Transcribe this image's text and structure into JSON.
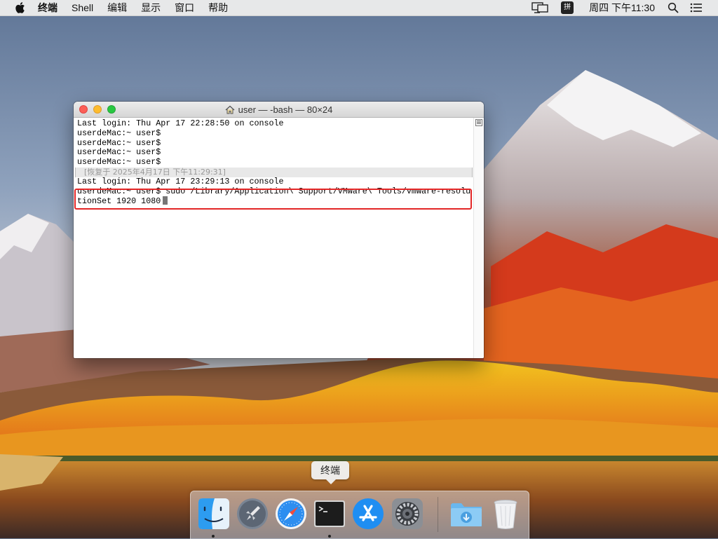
{
  "menubar": {
    "apple_icon": "apple-logo-icon",
    "app_name": "终端",
    "items": [
      "Shell",
      "编辑",
      "显示",
      "窗口",
      "帮助"
    ],
    "status": {
      "airplay_icon": "airplay-display-icon",
      "input_method": "拼",
      "clock": "周四 下午11:30",
      "search_icon": "spotlight-search-icon",
      "notification_icon": "notification-center-icon"
    }
  },
  "window": {
    "title": "user — -bash — 80×24",
    "title_icon": "home-folder-icon",
    "lines": [
      "Last login: Thu Apr 17 22:28:50 on console",
      "userdeMac:~ user$",
      "userdeMac:~ user$",
      "userdeMac:~ user$",
      "userdeMac:~ user$"
    ],
    "restored": "[恢复于 2025年4月17日 下午11:29:31]",
    "lines2": [
      "Last login: Thu Apr 17 23:29:13 on console",
      "userdeMac:~ user$ sudo /Library/Application\\ Support/VMware\\ Tools/vmware-resolu",
      "tionSet 1920 1080"
    ],
    "highlight_color": "#e32626"
  },
  "tooltip": {
    "text": "终端"
  },
  "dock": {
    "items": [
      {
        "name": "finder",
        "icon": "finder-icon",
        "running": true
      },
      {
        "name": "launchpad",
        "icon": "launchpad-rocket-icon",
        "running": false
      },
      {
        "name": "safari",
        "icon": "safari-compass-icon",
        "running": false
      },
      {
        "name": "terminal",
        "icon": "terminal-icon",
        "running": true
      },
      {
        "name": "app-store",
        "icon": "app-store-icon",
        "running": false
      },
      {
        "name": "system-preferences",
        "icon": "system-preferences-gear-icon",
        "running": false
      },
      {
        "name": "downloads",
        "icon": "downloads-folder-icon",
        "running": false
      },
      {
        "name": "trash",
        "icon": "trash-icon",
        "running": false
      }
    ]
  },
  "colors": {
    "close": "#fc5f57",
    "minimize": "#fdbc2e",
    "maximize": "#28c841"
  }
}
